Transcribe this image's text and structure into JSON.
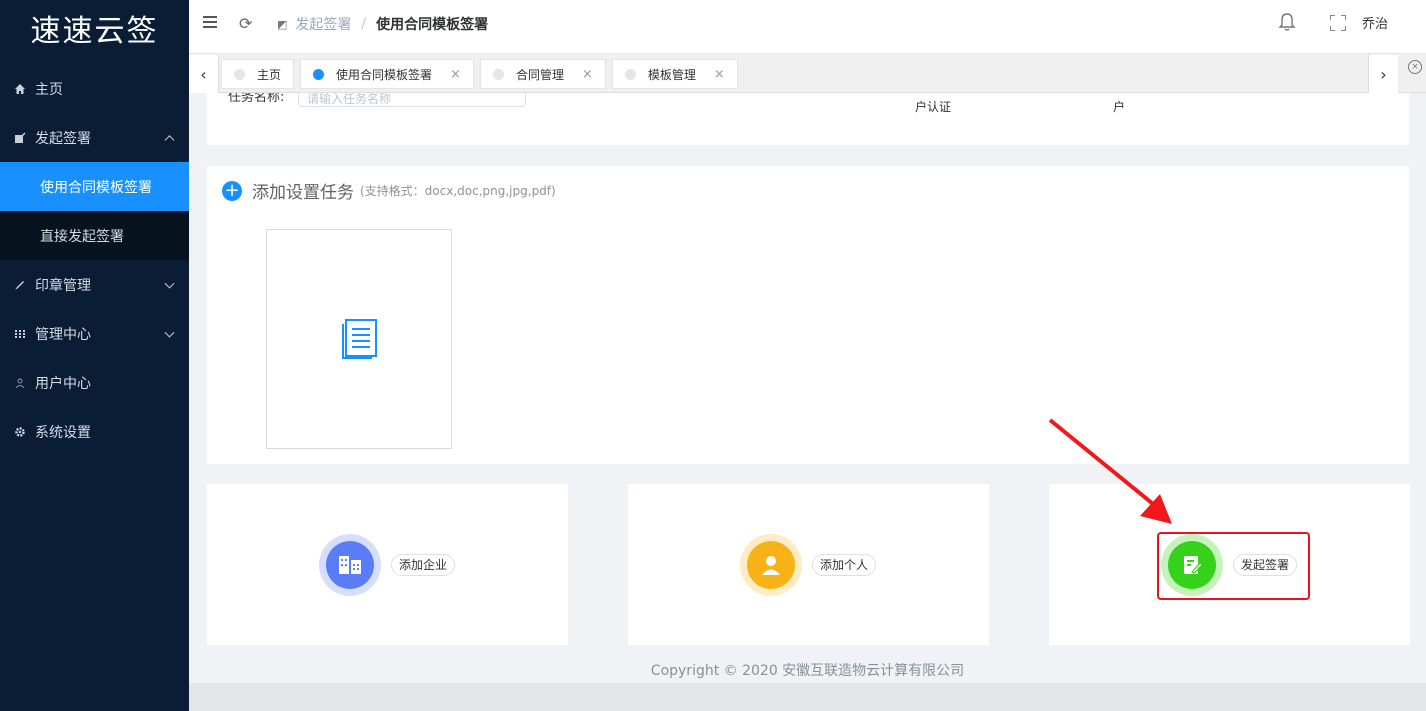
{
  "app": {
    "logo": "速速云签"
  },
  "sidebar": {
    "items": [
      {
        "label": "主页",
        "icon": "home-icon"
      },
      {
        "label": "发起签署",
        "icon": "sign-icon",
        "expanded": true,
        "children": [
          {
            "label": "使用合同模板签署",
            "active": true
          },
          {
            "label": "直接发起签署"
          }
        ]
      },
      {
        "label": "印章管理",
        "icon": "brush-icon"
      },
      {
        "label": "管理中心",
        "icon": "grid-icon"
      },
      {
        "label": "用户中心",
        "icon": "user-icon"
      },
      {
        "label": "系统设置",
        "icon": "gear-icon"
      }
    ]
  },
  "header": {
    "breadcrumb": [
      "发起签署",
      "使用合同模板签署"
    ],
    "user": "乔治"
  },
  "tabs": [
    {
      "label": "主页",
      "active": false,
      "closable": false
    },
    {
      "label": "使用合同模板签署",
      "active": true,
      "closable": true
    },
    {
      "label": "合同管理",
      "active": false,
      "closable": true
    },
    {
      "label": "模板管理",
      "active": false,
      "closable": true
    }
  ],
  "top_card": {
    "label": "任务名称:",
    "placeholder": "请输入任务名称",
    "col_a": "户认证",
    "col_b": "户"
  },
  "task": {
    "title": "添加设置任务",
    "hint": "(支持格式：docx,doc,png,jpg,pdf)"
  },
  "actions": [
    {
      "label": "添加企业",
      "color": "#5b7cf7"
    },
    {
      "label": "添加个人",
      "color": "#f7b217"
    },
    {
      "label": "发起签署",
      "color": "#36d11a"
    }
  ],
  "colors": {
    "accent": "#1890ff",
    "sidebar": "#0a1d35",
    "highlight": "#e8141c"
  },
  "footer": "Copyright © 2020 安徽互联造物云计算有限公司"
}
